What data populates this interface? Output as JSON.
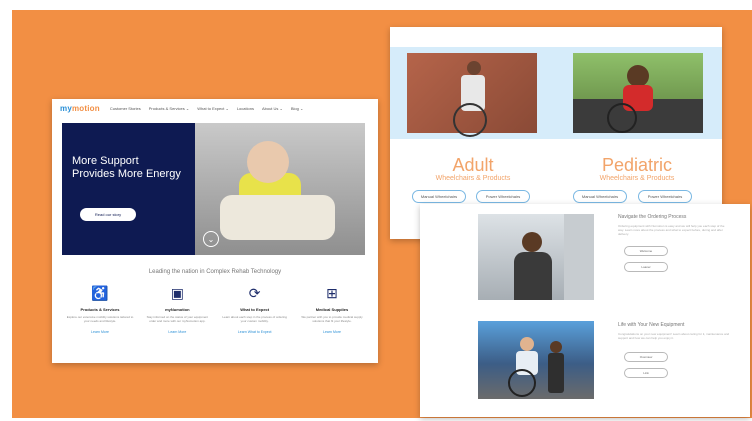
{
  "screenshot1": {
    "logo": {
      "prefix": "my",
      "main": "motion"
    },
    "nav": [
      "Customer Stories",
      "Products & Services ⌄",
      "What to Expect ⌄",
      "Locations",
      "About Us ⌄",
      "Blog ⌄"
    ],
    "hero": {
      "title": "More Support Provides More Energy",
      "button": "Read our story"
    },
    "leading": "Leading the nation in Complex Rehab Technology",
    "cards": [
      {
        "icon": "wheelchair-icon",
        "title": "Products & Services",
        "text": "Explore our extensive mobility solutions tailored to your needs and lifestyle.",
        "link": "Learn More"
      },
      {
        "icon": "monitor-icon",
        "title": "myNumotion",
        "text": "Stay informed on the status of your equipment order and more with our myNumotion app.",
        "link": "Learn More"
      },
      {
        "icon": "circle-arrows-icon",
        "title": "What to Expect",
        "text": "Learn about each step in the process of ordering your custom mobility.",
        "link": "Learn What to Expect"
      },
      {
        "icon": "box-icon",
        "title": "Medical Supplies",
        "text": "We partner with you to provide medical supply solutions that fit your lifestyle.",
        "link": "Learn More"
      }
    ]
  },
  "screenshot2": {
    "adult": {
      "title": "Adult",
      "subtitle": "Wheelchairs & Products",
      "buttons": [
        "Manual Wheelchairs",
        "Power Wheelchairs"
      ]
    },
    "pediatric": {
      "title": "Pediatric",
      "subtitle": "Wheelchairs & Products",
      "buttons": [
        "Manual Wheelchairs",
        "Power Wheelchairs"
      ]
    }
  },
  "screenshot3": {
    "section1": {
      "heading": "Navigate the Ordering Process",
      "text": "Ordering equipment with Numotion is easy and we will help you each step of the way. Learn more about the process and what to expect before, during and after delivery.",
      "buttons": [
        "Welcome",
        "Loaner"
      ]
    },
    "section2": {
      "heading": "Life with Your New Equipment",
      "text": "Congratulations on your new equipment! Learn about caring for it, maintenance and support and how we can help you enjoy it.",
      "buttons": [
        "Overview",
        "Link"
      ]
    }
  },
  "colors": {
    "background": "#f28f44",
    "navy": "#0e1a52",
    "accent_blue": "#2a8fd6",
    "peach": "#f2a46a"
  }
}
